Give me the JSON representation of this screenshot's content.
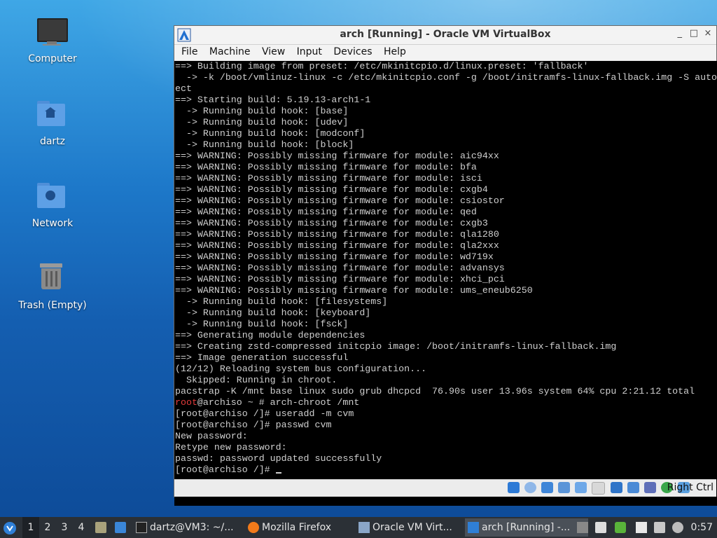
{
  "desktop": {
    "icons": [
      {
        "label": "Computer",
        "icon": "monitor-icon"
      },
      {
        "label": "dartz",
        "icon": "home-folder-icon"
      },
      {
        "label": "Network",
        "icon": "network-folder-icon"
      },
      {
        "label": "Trash (Empty)",
        "icon": "trash-icon"
      }
    ]
  },
  "vbox": {
    "title": "arch [Running] - Oracle VM VirtualBox",
    "window_controls": [
      "_",
      "□",
      "×"
    ],
    "menu": [
      "File",
      "Machine",
      "View",
      "Input",
      "Devices",
      "Help"
    ],
    "host_key": "Right Ctrl"
  },
  "console": {
    "lines": [
      "==> Building image from preset: /etc/mkinitcpio.d/linux.preset: 'fallback'",
      "  -> -k /boot/vmlinuz-linux -c /etc/mkinitcpio.conf -g /boot/initramfs-linux-fallback.img -S autod",
      "ect",
      "==> Starting build: 5.19.13-arch1-1",
      "  -> Running build hook: [base]",
      "  -> Running build hook: [udev]",
      "  -> Running build hook: [modconf]",
      "  -> Running build hook: [block]",
      "==> WARNING: Possibly missing firmware for module: aic94xx",
      "==> WARNING: Possibly missing firmware for module: bfa",
      "==> WARNING: Possibly missing firmware for module: isci",
      "==> WARNING: Possibly missing firmware for module: cxgb4",
      "==> WARNING: Possibly missing firmware for module: csiostor",
      "==> WARNING: Possibly missing firmware for module: qed",
      "==> WARNING: Possibly missing firmware for module: cxgb3",
      "==> WARNING: Possibly missing firmware for module: qla1280",
      "==> WARNING: Possibly missing firmware for module: qla2xxx",
      "==> WARNING: Possibly missing firmware for module: wd719x",
      "==> WARNING: Possibly missing firmware for module: advansys",
      "==> WARNING: Possibly missing firmware for module: xhci_pci",
      "==> WARNING: Possibly missing firmware for module: ums_eneub6250",
      "  -> Running build hook: [filesystems]",
      "  -> Running build hook: [keyboard]",
      "  -> Running build hook: [fsck]",
      "==> Generating module dependencies",
      "==> Creating zstd-compressed initcpio image: /boot/initramfs-linux-fallback.img",
      "==> Image generation successful",
      "(12/12) Reloading system bus configuration...",
      "  Skipped: Running in chroot.",
      "pacstrap -K /mnt base linux sudo grub dhcpcd  76.90s user 13.96s system 64% cpu 2:21.12 total",
      "~ # arch-chroot /mnt",
      "[root@archiso /]# useradd -m cvm",
      "[root@archiso /]# passwd cvm",
      "New password:",
      "Retype new password:",
      "passwd: password updated successfully",
      "[root@archiso /]# "
    ],
    "red_prefix": "root",
    "prompt_host": "@archiso "
  },
  "taskbar": {
    "workspaces": [
      "1",
      "2",
      "3",
      "4"
    ],
    "active_workspace": "1",
    "tasks": [
      {
        "label": "dartz@VM3: ~/...",
        "icon": "terminal-icon"
      },
      {
        "label": "Mozilla Firefox",
        "icon": "firefox-icon"
      },
      {
        "label": "Oracle VM Virt...",
        "icon": "virtualbox-icon"
      },
      {
        "label": "arch [Running] -...",
        "icon": "arch-icon"
      }
    ],
    "clock": "0:57"
  },
  "colors": {
    "accent": "#1d78c9",
    "console_red": "#e23b3b",
    "taskbar_bg": "#2b3036"
  }
}
